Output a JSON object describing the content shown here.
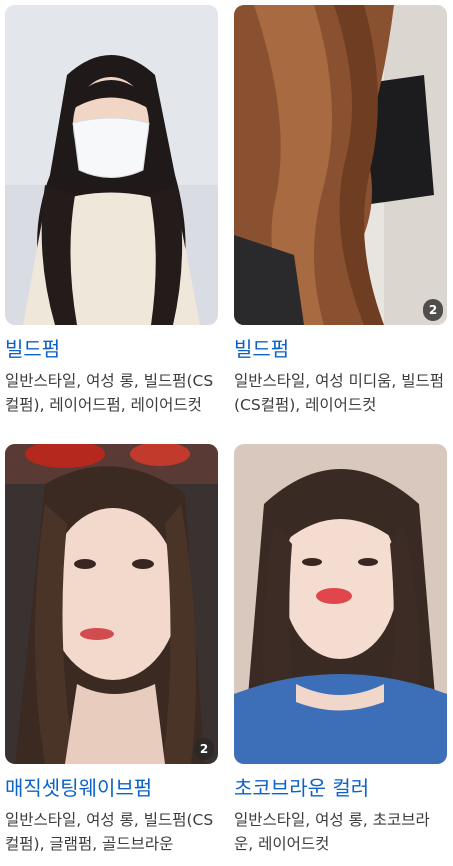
{
  "cards": [
    {
      "title": "빌드펌",
      "tags": "일반스타일, 여성 롱, 빌드펌(CS컬펌), 레이어드펌, 레이어드컷",
      "photo_count": ""
    },
    {
      "title": "빌드펌",
      "tags": "일반스타일, 여성 미디움, 빌드펌(CS컬펌), 레이어드컷",
      "photo_count": "2"
    },
    {
      "title": "매직셋팅웨이브펌",
      "tags": "일반스타일, 여성 롱, 빌드펌(CS컬펌), 글램펌, 골드브라운",
      "photo_count": "2"
    },
    {
      "title": "초코브라운 컬러",
      "tags": "일반스타일, 여성 롱, 초코브라운, 레이어드컷",
      "photo_count": ""
    }
  ],
  "colors": {
    "title_link": "#0b63c9",
    "tag_text": "#3c3c3c",
    "badge_bg": "#2d2d2d"
  }
}
